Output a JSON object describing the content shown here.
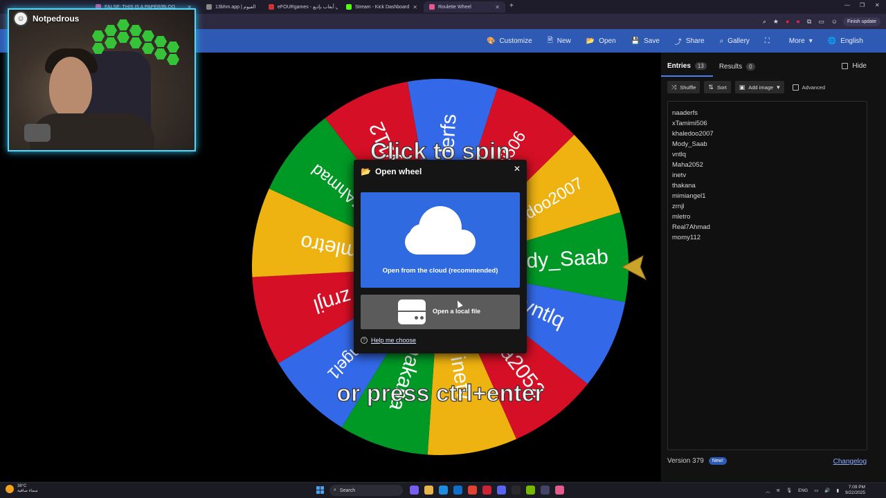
{
  "browser": {
    "tabs": [
      {
        "label": "FALSE: THIS IS A PAPER/BLOG",
        "color": "#d04a9a",
        "active": false
      },
      {
        "label": "13bhm.app | العيوم",
        "color": "#888888",
        "active": false
      },
      {
        "label": "eFOURgames - تعاطي أبعاب بإذيع",
        "color": "#cc3333",
        "active": false
      },
      {
        "label": "Stream - Kick Dashboard",
        "color": "#53fc18",
        "active": false
      },
      {
        "label": "Roulette Wheel",
        "color": "#e25b8c",
        "active": true
      }
    ],
    "finish_update": "Finish update"
  },
  "toolbar": {
    "items": [
      {
        "label": "Customize",
        "icon": "palette-icon"
      },
      {
        "label": "New",
        "icon": "file-icon"
      },
      {
        "label": "Open",
        "icon": "folder-icon"
      },
      {
        "label": "Save",
        "icon": "save-icon"
      },
      {
        "label": "Share",
        "icon": "share-icon"
      },
      {
        "label": "Gallery",
        "icon": "search-icon"
      },
      {
        "label": "",
        "icon": "fullscreen-icon"
      },
      {
        "label": "More",
        "icon": "chevron-down-icon"
      },
      {
        "label": "English",
        "icon": "globe-icon"
      }
    ]
  },
  "webcam": {
    "name": "Notpedrous"
  },
  "wheel": {
    "segments": [
      {
        "label": "naaderfs",
        "color": "#3369e8"
      },
      {
        "label": "xTamimi506",
        "color": "#d50f25"
      },
      {
        "label": "khaledoo2007",
        "color": "#eeb211"
      },
      {
        "label": "Mody_Saab",
        "color": "#009925"
      },
      {
        "label": "vntlq",
        "color": "#3369e8"
      },
      {
        "label": "Maha2052",
        "color": "#d50f25"
      },
      {
        "label": "inetv",
        "color": "#eeb211"
      },
      {
        "label": "thakana",
        "color": "#009925"
      },
      {
        "label": "mimiangel1",
        "color": "#3369e8"
      },
      {
        "label": "zrnjl",
        "color": "#d50f25"
      },
      {
        "label": "mletro",
        "color": "#eeb211"
      },
      {
        "label": "Real7Ahmad",
        "color": "#009925"
      },
      {
        "label": "momy112",
        "color": "#d50f25"
      }
    ],
    "overlay_top": "Click to spin",
    "overlay_bottom": "or press ctrl+enter",
    "pointer_color": "#c9a32a"
  },
  "modal": {
    "title": "Open wheel",
    "cloud_label": "Open from the cloud (recommended)",
    "local_label": "Open a local file",
    "help_label": "Help me choose"
  },
  "panel": {
    "entries_tab": "Entries",
    "entries_count": "13",
    "results_tab": "Results",
    "results_count": "0",
    "hide_label": "Hide",
    "shuffle_label": "Shuffle",
    "sort_label": "Sort",
    "add_image_label": "Add image",
    "advanced_label": "Advanced",
    "entries": [
      "naaderfs",
      "xTamimi506",
      "khaledoo2007",
      "Mody_Saab",
      "vntlq",
      "Maha2052",
      "inetv",
      "thakana",
      "mimiangel1",
      "zrnjl",
      "mletro",
      "Real7Ahmad",
      "momy112"
    ],
    "version": "Version 379",
    "new_badge": "New!",
    "changelog": "Changelog"
  },
  "taskbar": {
    "temp": "38°C",
    "weather_text": "سماء صافية",
    "search": "Search",
    "lang": "ENG",
    "time": "7:09 PM",
    "date": "9/22/2025"
  }
}
